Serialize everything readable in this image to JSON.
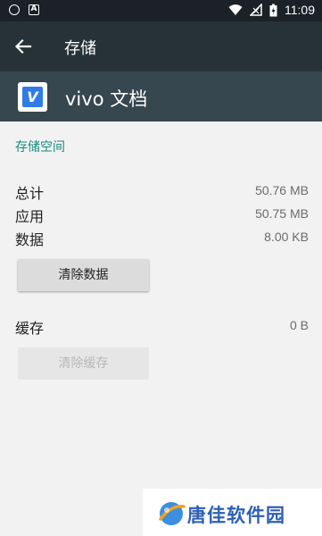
{
  "status_bar": {
    "time": "11:09",
    "icons": [
      "shield-icon",
      "a-icon",
      "wifi-icon",
      "signal-icon",
      "battery-icon"
    ]
  },
  "app_bar": {
    "title": "存储"
  },
  "app_header": {
    "name": "vivo 文档",
    "icon_letter": "V"
  },
  "storage": {
    "section_title": "存储空间",
    "rows": [
      {
        "label": "总计",
        "value": "50.76 MB"
      },
      {
        "label": "应用",
        "value": "50.75 MB"
      },
      {
        "label": "数据",
        "value": "8.00 KB"
      }
    ],
    "clear_data_label": "清除数据"
  },
  "cache": {
    "label": "缓存",
    "value": "0 B",
    "clear_cache_label": "清除缓存"
  },
  "watermark": {
    "text": "唐佳软件园"
  },
  "colors": {
    "status_bar": "#1b2126",
    "app_bar": "#263238",
    "app_header": "#37474f",
    "section_accent": "#1a8a80",
    "app_icon": "#2f7ce8"
  }
}
